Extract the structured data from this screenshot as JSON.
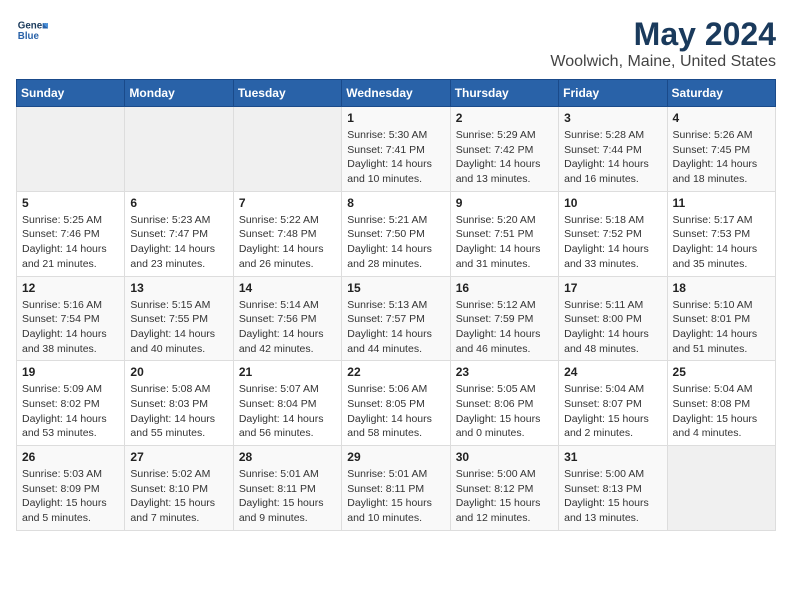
{
  "logo": {
    "line1": "General",
    "line2": "Blue"
  },
  "title": "May 2024",
  "subtitle": "Woolwich, Maine, United States",
  "days_header": [
    "Sunday",
    "Monday",
    "Tuesday",
    "Wednesday",
    "Thursday",
    "Friday",
    "Saturday"
  ],
  "weeks": [
    [
      {
        "day": "",
        "info": ""
      },
      {
        "day": "",
        "info": ""
      },
      {
        "day": "",
        "info": ""
      },
      {
        "day": "1",
        "info": "Sunrise: 5:30 AM\nSunset: 7:41 PM\nDaylight: 14 hours\nand 10 minutes."
      },
      {
        "day": "2",
        "info": "Sunrise: 5:29 AM\nSunset: 7:42 PM\nDaylight: 14 hours\nand 13 minutes."
      },
      {
        "day": "3",
        "info": "Sunrise: 5:28 AM\nSunset: 7:44 PM\nDaylight: 14 hours\nand 16 minutes."
      },
      {
        "day": "4",
        "info": "Sunrise: 5:26 AM\nSunset: 7:45 PM\nDaylight: 14 hours\nand 18 minutes."
      }
    ],
    [
      {
        "day": "5",
        "info": "Sunrise: 5:25 AM\nSunset: 7:46 PM\nDaylight: 14 hours\nand 21 minutes."
      },
      {
        "day": "6",
        "info": "Sunrise: 5:23 AM\nSunset: 7:47 PM\nDaylight: 14 hours\nand 23 minutes."
      },
      {
        "day": "7",
        "info": "Sunrise: 5:22 AM\nSunset: 7:48 PM\nDaylight: 14 hours\nand 26 minutes."
      },
      {
        "day": "8",
        "info": "Sunrise: 5:21 AM\nSunset: 7:50 PM\nDaylight: 14 hours\nand 28 minutes."
      },
      {
        "day": "9",
        "info": "Sunrise: 5:20 AM\nSunset: 7:51 PM\nDaylight: 14 hours\nand 31 minutes."
      },
      {
        "day": "10",
        "info": "Sunrise: 5:18 AM\nSunset: 7:52 PM\nDaylight: 14 hours\nand 33 minutes."
      },
      {
        "day": "11",
        "info": "Sunrise: 5:17 AM\nSunset: 7:53 PM\nDaylight: 14 hours\nand 35 minutes."
      }
    ],
    [
      {
        "day": "12",
        "info": "Sunrise: 5:16 AM\nSunset: 7:54 PM\nDaylight: 14 hours\nand 38 minutes."
      },
      {
        "day": "13",
        "info": "Sunrise: 5:15 AM\nSunset: 7:55 PM\nDaylight: 14 hours\nand 40 minutes."
      },
      {
        "day": "14",
        "info": "Sunrise: 5:14 AM\nSunset: 7:56 PM\nDaylight: 14 hours\nand 42 minutes."
      },
      {
        "day": "15",
        "info": "Sunrise: 5:13 AM\nSunset: 7:57 PM\nDaylight: 14 hours\nand 44 minutes."
      },
      {
        "day": "16",
        "info": "Sunrise: 5:12 AM\nSunset: 7:59 PM\nDaylight: 14 hours\nand 46 minutes."
      },
      {
        "day": "17",
        "info": "Sunrise: 5:11 AM\nSunset: 8:00 PM\nDaylight: 14 hours\nand 48 minutes."
      },
      {
        "day": "18",
        "info": "Sunrise: 5:10 AM\nSunset: 8:01 PM\nDaylight: 14 hours\nand 51 minutes."
      }
    ],
    [
      {
        "day": "19",
        "info": "Sunrise: 5:09 AM\nSunset: 8:02 PM\nDaylight: 14 hours\nand 53 minutes."
      },
      {
        "day": "20",
        "info": "Sunrise: 5:08 AM\nSunset: 8:03 PM\nDaylight: 14 hours\nand 55 minutes."
      },
      {
        "day": "21",
        "info": "Sunrise: 5:07 AM\nSunset: 8:04 PM\nDaylight: 14 hours\nand 56 minutes."
      },
      {
        "day": "22",
        "info": "Sunrise: 5:06 AM\nSunset: 8:05 PM\nDaylight: 14 hours\nand 58 minutes."
      },
      {
        "day": "23",
        "info": "Sunrise: 5:05 AM\nSunset: 8:06 PM\nDaylight: 15 hours\nand 0 minutes."
      },
      {
        "day": "24",
        "info": "Sunrise: 5:04 AM\nSunset: 8:07 PM\nDaylight: 15 hours\nand 2 minutes."
      },
      {
        "day": "25",
        "info": "Sunrise: 5:04 AM\nSunset: 8:08 PM\nDaylight: 15 hours\nand 4 minutes."
      }
    ],
    [
      {
        "day": "26",
        "info": "Sunrise: 5:03 AM\nSunset: 8:09 PM\nDaylight: 15 hours\nand 5 minutes."
      },
      {
        "day": "27",
        "info": "Sunrise: 5:02 AM\nSunset: 8:10 PM\nDaylight: 15 hours\nand 7 minutes."
      },
      {
        "day": "28",
        "info": "Sunrise: 5:01 AM\nSunset: 8:11 PM\nDaylight: 15 hours\nand 9 minutes."
      },
      {
        "day": "29",
        "info": "Sunrise: 5:01 AM\nSunset: 8:11 PM\nDaylight: 15 hours\nand 10 minutes."
      },
      {
        "day": "30",
        "info": "Sunrise: 5:00 AM\nSunset: 8:12 PM\nDaylight: 15 hours\nand 12 minutes."
      },
      {
        "day": "31",
        "info": "Sunrise: 5:00 AM\nSunset: 8:13 PM\nDaylight: 15 hours\nand 13 minutes."
      },
      {
        "day": "",
        "info": ""
      }
    ]
  ]
}
